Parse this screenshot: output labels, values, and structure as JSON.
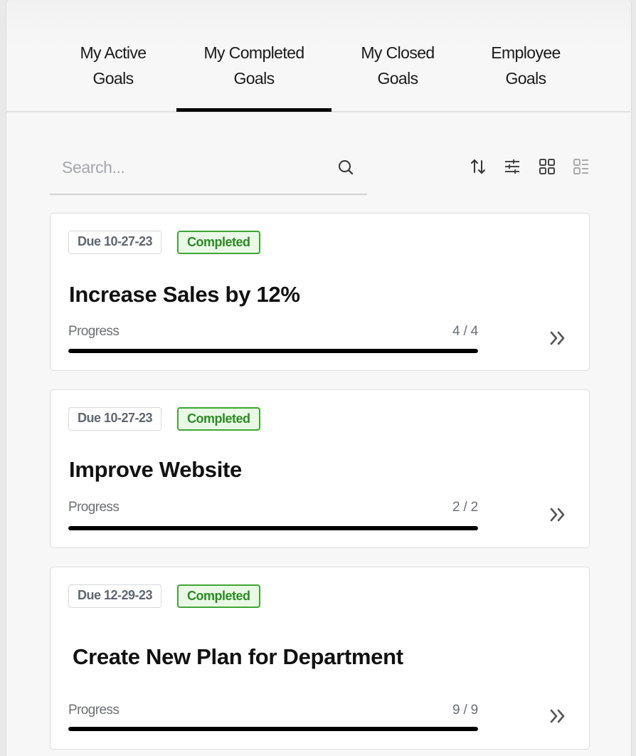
{
  "tabs": [
    {
      "label_line1": "My Active",
      "label_line2": "Goals",
      "selected": false
    },
    {
      "label_line1": "My Completed",
      "label_line2": "Goals",
      "selected": true
    },
    {
      "label_line1": "My Closed",
      "label_line2": "Goals",
      "selected": false
    },
    {
      "label_line1": "Employee",
      "label_line2": "Goals",
      "selected": false
    }
  ],
  "search": {
    "placeholder": "Search...",
    "value": ""
  },
  "toolbar": {
    "icons": [
      "sort-icon",
      "filter-icon",
      "grid-view-icon",
      "list-view-icon"
    ]
  },
  "goals": [
    {
      "due": "Due 10-27-23",
      "status": "Completed",
      "title": "Increase Sales by 12%",
      "progress_label": "Progress",
      "progress_text": "4 / 4",
      "progress_done": 4,
      "progress_total": 4
    },
    {
      "due": "Due 10-27-23",
      "status": "Completed",
      "title": "Improve Website",
      "progress_label": "Progress",
      "progress_text": "2 / 2",
      "progress_done": 2,
      "progress_total": 2
    },
    {
      "due": "Due 12-29-23",
      "status": "Completed",
      "title": "Create New Plan for Department",
      "progress_label": "Progress",
      "progress_text": "9 / 9",
      "progress_done": 9,
      "progress_total": 9
    }
  ],
  "colors": {
    "status_completed_text": "#2c8a25",
    "status_completed_border": "#3fa535",
    "status_completed_bg": "#eaf9e6",
    "tab_indicator": "#000000",
    "progress_fill": "#000000"
  }
}
